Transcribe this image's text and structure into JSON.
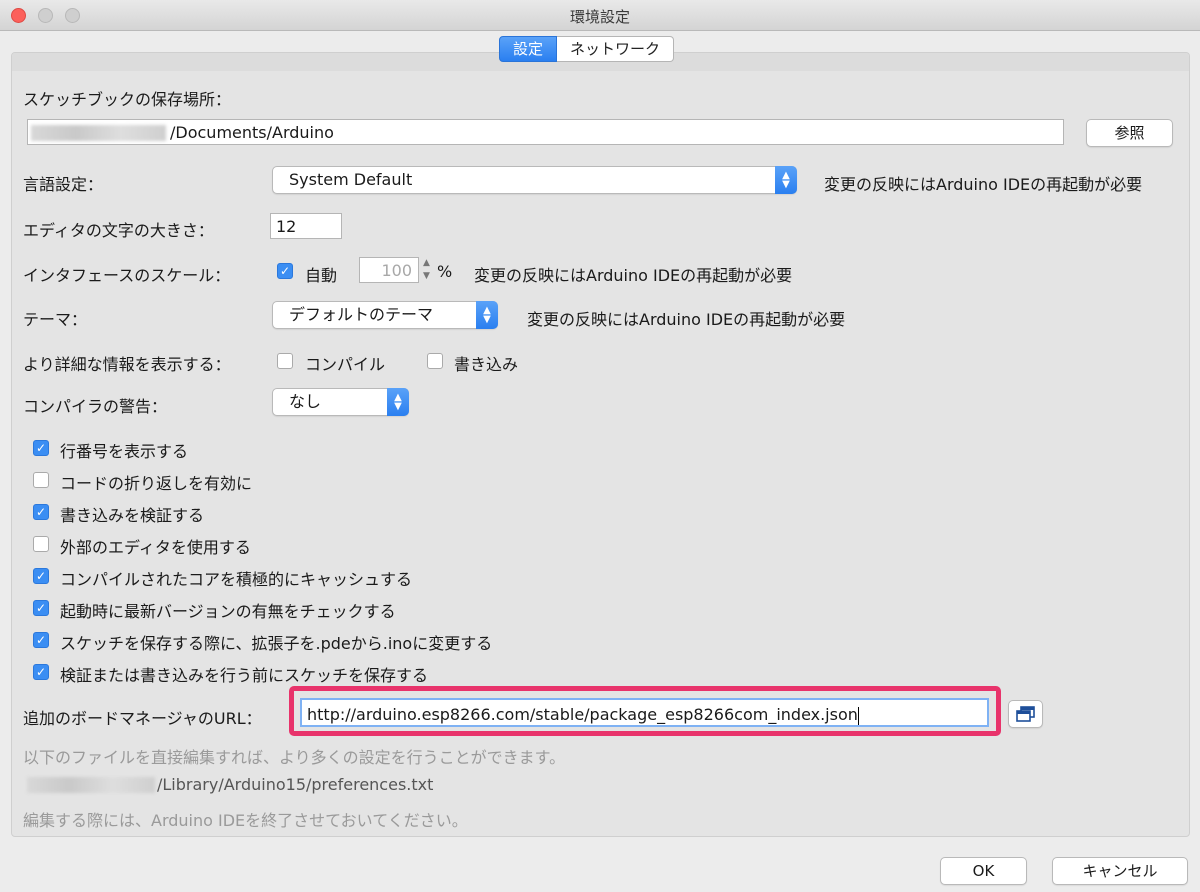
{
  "window": {
    "title": "環境設定"
  },
  "tabs": [
    {
      "label": "設定"
    },
    {
      "label": "ネットワーク"
    }
  ],
  "sketchbook": {
    "label": "スケッチブックの保存場所：",
    "path": "/Documents/Arduino",
    "browse_label": "参照"
  },
  "language": {
    "label": "言語設定：",
    "value": "System Default",
    "note": "変更の反映にはArduino IDEの再起動が必要"
  },
  "editor_font": {
    "label": "エディタの文字の大きさ：",
    "value": "12"
  },
  "scale": {
    "label": "インタフェースのスケール：",
    "auto_label": "自動",
    "auto_checked": true,
    "value": "100",
    "unit": "%",
    "note": "変更の反映にはArduino IDEの再起動が必要"
  },
  "theme": {
    "label": "テーマ：",
    "value": "デフォルトのテーマ",
    "note": "変更の反映にはArduino IDEの再起動が必要"
  },
  "verbose": {
    "label": "より詳細な情報を表示する：",
    "compile_label": "コンパイル",
    "compile_checked": false,
    "upload_label": "書き込み",
    "upload_checked": false
  },
  "warnings": {
    "label": "コンパイラの警告：",
    "value": "なし"
  },
  "options": [
    {
      "label": "行番号を表示する",
      "checked": true
    },
    {
      "label": "コードの折り返しを有効に",
      "checked": false
    },
    {
      "label": "書き込みを検証する",
      "checked": true
    },
    {
      "label": "外部のエディタを使用する",
      "checked": false
    },
    {
      "label": "コンパイルされたコアを積極的にキャッシュする",
      "checked": true
    },
    {
      "label": "起動時に最新バージョンの有無をチェックする",
      "checked": true
    },
    {
      "label": "スケッチを保存する際に、拡張子を.pdeから.inoに変更する",
      "checked": true
    },
    {
      "label": "検証または書き込みを行う前にスケッチを保存する",
      "checked": true
    }
  ],
  "board_urls": {
    "label": "追加のボードマネージャのURL：",
    "value": "http://arduino.esp8266.com/stable/package_esp8266com_index.json"
  },
  "footer": {
    "more_prefs": "以下のファイルを直接編集すれば、より多くの設定を行うことができます。",
    "prefs_path": "/Library/Arduino15/preferences.txt",
    "quit_note": "編集する際には、Arduino IDEを終了させておいてください。"
  },
  "buttons": {
    "ok": "OK",
    "cancel": "キャンセル"
  },
  "colors": {
    "accent": "#2a7ff0",
    "highlight": "#e8336b",
    "hint": "#9a9a9a"
  }
}
